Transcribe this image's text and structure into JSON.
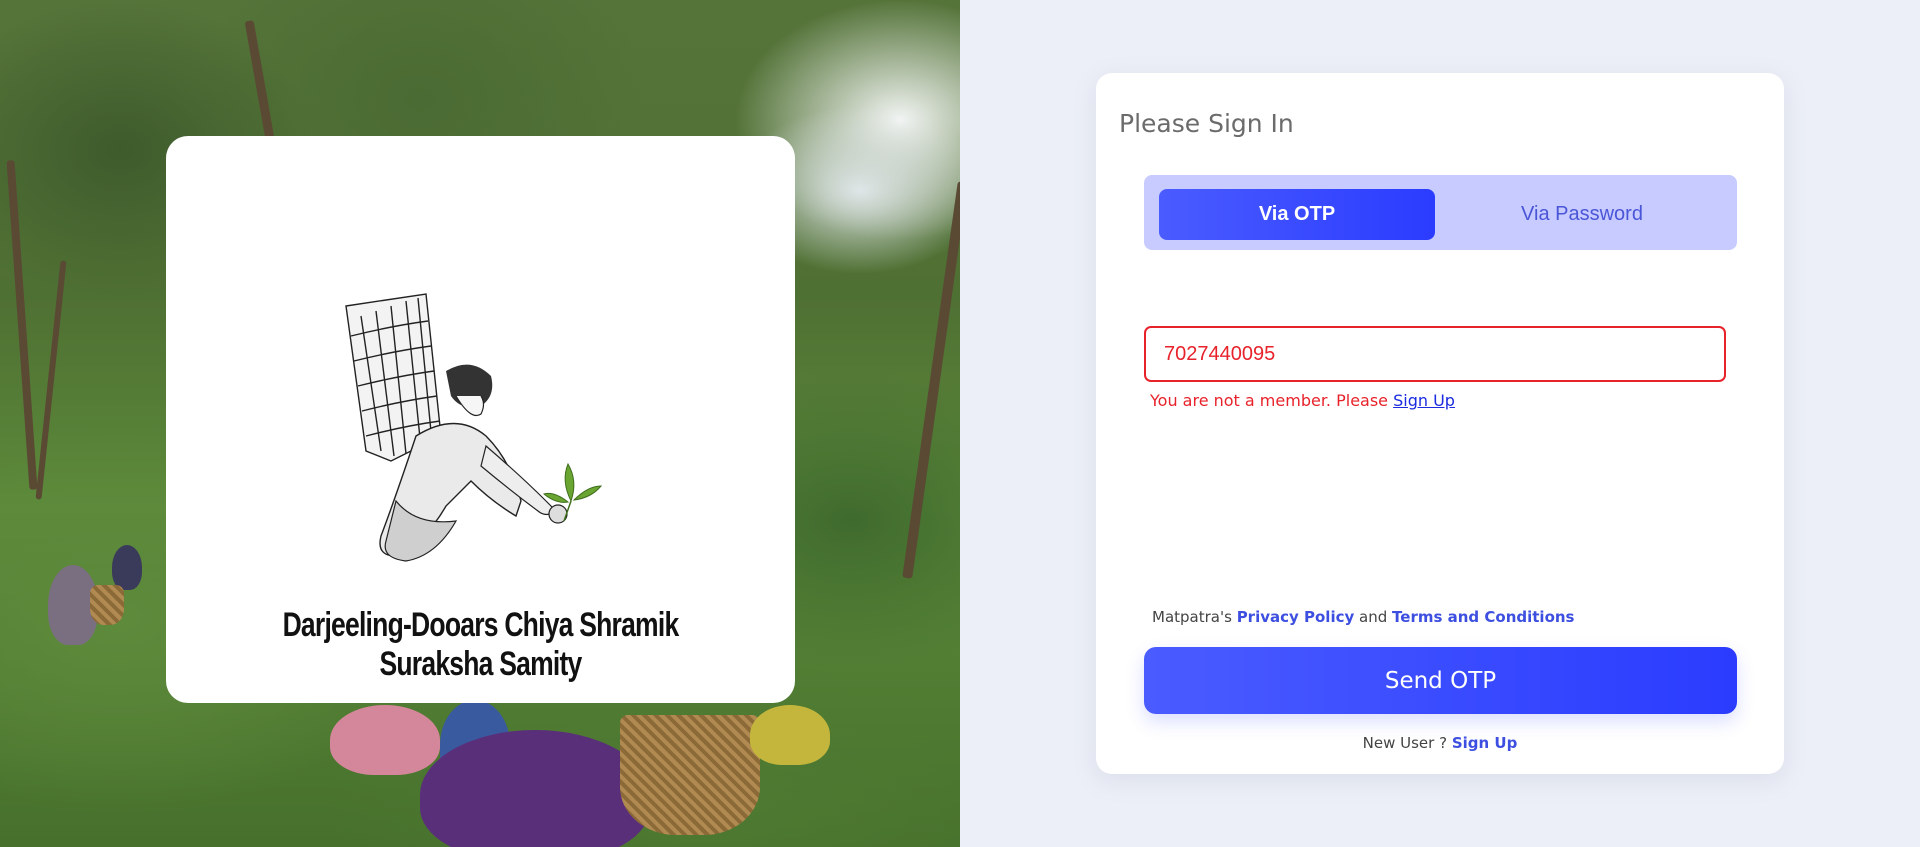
{
  "branding": {
    "organization_name": "Darjeeling-Dooars Chiya Shramik Suraksha Samity",
    "logo_icon": "tea-picker-logo-icon"
  },
  "signin": {
    "title": "Please Sign In",
    "tabs": [
      {
        "label": "Via OTP",
        "active": true
      },
      {
        "label": "Via Password",
        "active": false
      }
    ],
    "phone_value": "7027440095",
    "error": {
      "text": "You are not a member. Please ",
      "link": "Sign Up"
    },
    "policy": {
      "prefix": "Matpatra's ",
      "privacy": "Privacy Policy",
      "and": " and ",
      "terms": "Terms and Conditions"
    },
    "send_button": "Send OTP",
    "new_user": {
      "prefix": "New User ? ",
      "link": "Sign Up"
    }
  },
  "colors": {
    "accent": "#3d4fe0",
    "button_gradient_start": "#4a5cff",
    "button_gradient_end": "#2b3cff",
    "tab_bg": "#c7cbff",
    "error": "#e8222a",
    "page_bg": "#eceff7"
  }
}
